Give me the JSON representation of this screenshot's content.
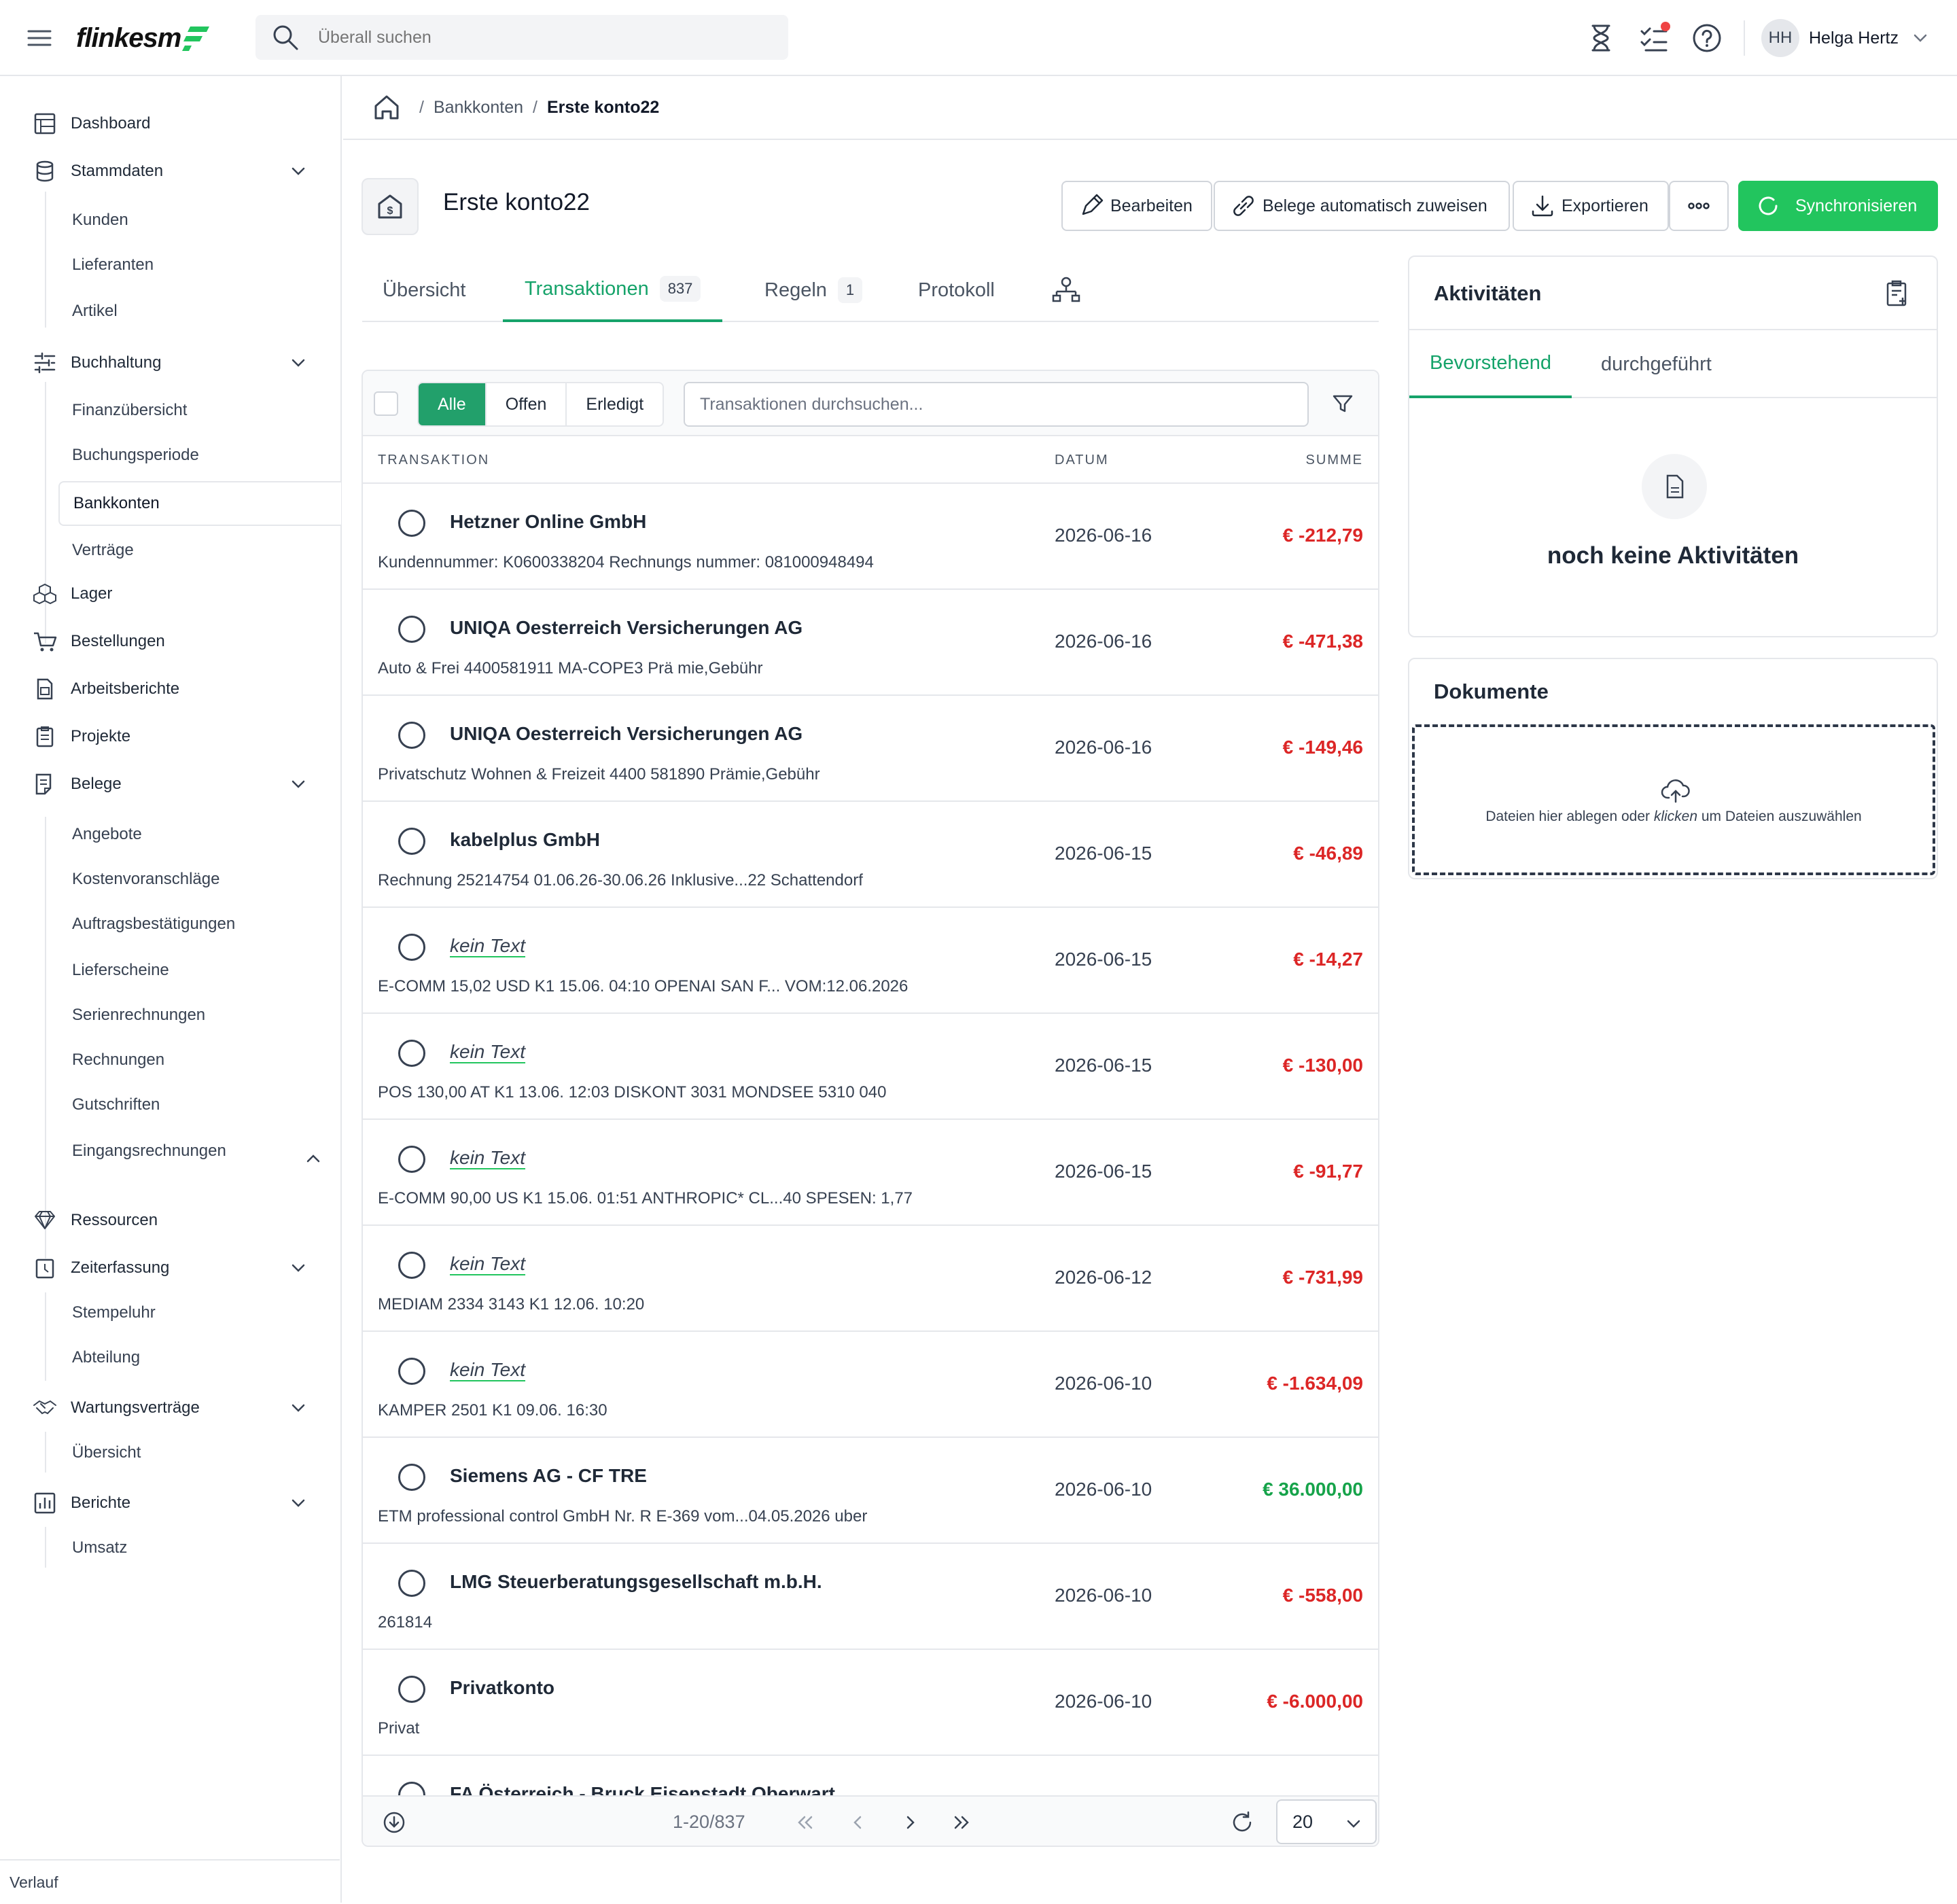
{
  "app": {
    "logo": "flinkesт"
  },
  "topbar": {
    "search_placeholder": "Überall suchen",
    "user_initials": "HH",
    "user_name": "Helga Hertz"
  },
  "sidebar": {
    "items": [
      {
        "label": "Dashboard"
      },
      {
        "label": "Stammdaten"
      },
      {
        "label": "Kunden"
      },
      {
        "label": "Lieferanten"
      },
      {
        "label": "Artikel"
      },
      {
        "label": "Buchhaltung"
      },
      {
        "label": "Finanzübersicht"
      },
      {
        "label": "Buchungsperiode"
      },
      {
        "label": "Bankkonten"
      },
      {
        "label": "Verträge"
      },
      {
        "label": "Lager"
      },
      {
        "label": "Bestellungen"
      },
      {
        "label": "Arbeitsberichte"
      },
      {
        "label": "Projekte"
      },
      {
        "label": "Belege"
      },
      {
        "label": "Angebote"
      },
      {
        "label": "Kostenvoranschläge"
      },
      {
        "label": "Auftragsbestätigungen"
      },
      {
        "label": "Lieferscheine"
      },
      {
        "label": "Serienrechnungen"
      },
      {
        "label": "Rechnungen"
      },
      {
        "label": "Gutschriften"
      },
      {
        "label": "Eingangsrechnungen"
      },
      {
        "label": "Ressourcen"
      },
      {
        "label": "Zeiterfassung"
      },
      {
        "label": "Stempeluhr"
      },
      {
        "label": "Abteilung"
      },
      {
        "label": "Wartungsverträge"
      },
      {
        "label": "Übersicht"
      },
      {
        "label": "Berichte"
      },
      {
        "label": "Umsatz"
      }
    ],
    "footer": "Verlauf"
  },
  "breadcrumb": {
    "sep": "/",
    "parent": "Bankkonten",
    "current": "Erste konto22"
  },
  "page": {
    "title": "Erste konto22",
    "buttons": {
      "edit": "Bearbeiten",
      "auto_assign": "Belege automatisch zuweisen",
      "export": "Exportieren",
      "sync": "Synchronisieren"
    }
  },
  "tabs": {
    "overview": "Übersicht",
    "transactions": "Transaktionen",
    "transactions_count": "837",
    "rules": "Regeln",
    "rules_count": "1",
    "log": "Protokoll"
  },
  "filters": {
    "all": "Alle",
    "open": "Offen",
    "done": "Erledigt",
    "search_placeholder": "Transaktionen durchsuchen..."
  },
  "table": {
    "columns": {
      "transaction": "TRANSAKTION",
      "date": "DATUM",
      "sum": "SUMME"
    },
    "rows": [
      {
        "title": "Hetzner Online GmbH",
        "sub": "Kundennummer: K0600338204 Rechnungs nummer: 081000948494",
        "date": "2026-06-16",
        "amount": "€ -212,79"
      },
      {
        "title": "UNIQA Oesterreich Versicherungen AG",
        "sub": "Auto & Frei 4400581911 MA-COPE3 Prä mie,Gebühr",
        "date": "2026-06-16",
        "amount": "€ -471,38"
      },
      {
        "title": "UNIQA Oesterreich Versicherungen AG",
        "sub": "Privatschutz Wohnen & Freizeit 4400 581890 Prämie,Gebühr",
        "date": "2026-06-16",
        "amount": "€ -149,46"
      },
      {
        "title": "kabelplus GmbH",
        "sub": "Rechnung 25214754 01.06.26-30.06.26 Inklusive...22 Schattendorf",
        "date": "2026-06-15",
        "amount": "€ -46,89"
      },
      {
        "title": "kein Text",
        "sub": "E-COMM 15,02 USD K1 15.06. 04:10 OPENAI SAN F... VOM:12.06.2026",
        "date": "2026-06-15",
        "amount": "€ -14,27"
      },
      {
        "title": "kein Text",
        "sub": "POS 130,00 AT K1 13.06. 12:03 DISKONT 3031 MONDSEE 5310 040",
        "date": "2026-06-15",
        "amount": "€ -130,00"
      },
      {
        "title": "kein Text",
        "sub": "E-COMM 90,00 US K1 15.06. 01:51 ANTHROPIC* CL...40 SPESEN: 1,77",
        "date": "2026-06-15",
        "amount": "€ -91,77"
      },
      {
        "title": "kein Text",
        "sub": "MEDIAM 2334 3143 K1 12.06. 10:20",
        "date": "2026-06-12",
        "amount": "€ -731,99"
      },
      {
        "title": "kein Text",
        "sub": "KAMPER 2501 K1 09.06. 16:30",
        "date": "2026-06-10",
        "amount": "€ -1.634,09"
      },
      {
        "title": "Siemens AG - CF TRE",
        "sub": "ETM professional control GmbH Nr. R E-369 vom...04.05.2026 uber",
        "date": "2026-06-10",
        "amount": "€ 36.000,00"
      },
      {
        "title": "LMG Steuerberatungsgesellschaft m.b.H.",
        "sub": "261814",
        "date": "2026-06-10",
        "amount": "€ -558,00"
      },
      {
        "title": "Privatkonto",
        "sub": "Privat",
        "date": "2026-06-10",
        "amount": "€ -6.000,00"
      },
      {
        "title": "FA Österreich - Bruck Eisenstadt Oberwart",
        "sub": "",
        "date": "",
        "amount": ""
      }
    ]
  },
  "pager": {
    "range": "1-20/837",
    "page_size": "20"
  },
  "activities": {
    "title": "Aktivitäten",
    "tab_upcoming": "Bevorstehend",
    "tab_done": "durchgeführt",
    "empty": "noch keine Aktivitäten"
  },
  "documents": {
    "title": "Dokumente",
    "drop_pre": "Dateien hier ablegen oder ",
    "drop_em": "klicken",
    "drop_post": " um Dateien auszuwählen"
  },
  "colors": {
    "accent": "#16a36a",
    "primary_button": "#22c55e",
    "negative": "#dc2626",
    "positive": "#16a34a"
  }
}
